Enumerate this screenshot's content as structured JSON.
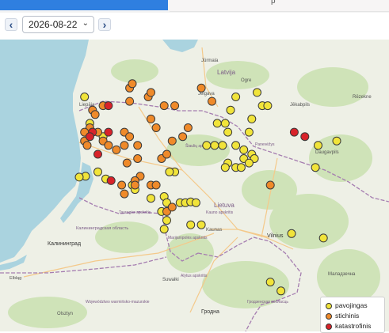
{
  "tabs": {
    "active_label": "",
    "inactive_label": "p"
  },
  "toolbar": {
    "prev_label": "‹",
    "next_label": "›",
    "date_value": "2026-08-22"
  },
  "map_labels": {
    "latvija": "Latvija",
    "lietuva": "Lietuva",
    "jurmala": "Jūrmala",
    "jelgava": "Jelgava",
    "ogre": "Ogre",
    "liepaja": "Liepāja",
    "jekabpils": "Jēkabpils",
    "rezekne": "Rēzekne",
    "daugavpils": "Daugavpils",
    "vilnius": "Vilnius",
    "kaunas": "Kaunas",
    "kaliningrad": "Калининград",
    "kaliningrad_oblast": "Калининградская область",
    "suwalki": "Suwałki",
    "grodno": "Гродна",
    "elblag": "Elbląg",
    "olsztyn": "Olsztyn",
    "warminsko": "Województwo warmińsko-mazurskie",
    "molodechno": "Маладзечна",
    "grodno_obl": "Гродзенская вобласць",
    "alytus": "Alytus apskritis",
    "kauno": "Kauno apskritis",
    "siauliu": "Šiaulių apskritis",
    "panevezys": "Panevėžys",
    "marijampole": "Marijampolės apskritis",
    "taurages": "Tauragės apskritis"
  },
  "legend": {
    "items": [
      {
        "label": "pavojingas",
        "color": "#f1e43a"
      },
      {
        "label": "stichinis",
        "color": "#ef8a2a"
      },
      {
        "label": "katastrofinis",
        "color": "#d8232a"
      }
    ]
  },
  "markers": {
    "pavojingas": [
      [
        21.1,
        56.05
      ],
      [
        21.2,
        55.75
      ],
      [
        21.45,
        55.6
      ],
      [
        21.35,
        55.2
      ],
      [
        21.12,
        55.15
      ],
      [
        21.0,
        55.14
      ],
      [
        21.5,
        55.12
      ],
      [
        22.0,
        55.05
      ],
      [
        22.05,
        55.0
      ],
      [
        22.35,
        54.9
      ],
      [
        22.6,
        54.92
      ],
      [
        22.65,
        54.85
      ],
      [
        22.9,
        54.85
      ],
      [
        23.0,
        54.85
      ],
      [
        23.1,
        54.86
      ],
      [
        23.2,
        54.85
      ],
      [
        22.55,
        54.75
      ],
      [
        22.65,
        54.65
      ],
      [
        22.6,
        54.55
      ],
      [
        23.3,
        54.6
      ],
      [
        23.6,
        55.75
      ],
      [
        23.75,
        55.75
      ],
      [
        23.85,
        55.9
      ],
      [
        23.95,
        56.05
      ],
      [
        24.35,
        56.1
      ],
      [
        24.45,
        55.95
      ],
      [
        24.55,
        55.95
      ],
      [
        24.25,
        55.8
      ],
      [
        24.2,
        55.65
      ],
      [
        23.8,
        55.65
      ],
      [
        23.4,
        55.5
      ],
      [
        23.55,
        55.5
      ],
      [
        23.7,
        55.5
      ],
      [
        23.95,
        55.5
      ],
      [
        24.1,
        55.45
      ],
      [
        24.25,
        55.4
      ],
      [
        24.1,
        55.35
      ],
      [
        24.3,
        55.35
      ],
      [
        24.2,
        55.3
      ],
      [
        23.8,
        55.3
      ],
      [
        23.75,
        55.25
      ],
      [
        23.95,
        55.25
      ],
      [
        24.05,
        55.25
      ],
      [
        22.8,
        55.2
      ],
      [
        22.7,
        55.2
      ],
      [
        23.1,
        54.6
      ],
      [
        25.5,
        55.5
      ],
      [
        25.85,
        55.55
      ],
      [
        25.45,
        55.25
      ],
      [
        25.0,
        54.5
      ],
      [
        25.6,
        54.45
      ],
      [
        24.6,
        53.95
      ],
      [
        24.8,
        53.85
      ]
    ],
    "stichinis": [
      [
        21.45,
        55.95
      ],
      [
        21.25,
        55.9
      ],
      [
        21.3,
        55.85
      ],
      [
        21.2,
        55.7
      ],
      [
        21.25,
        55.65
      ],
      [
        21.35,
        55.65
      ],
      [
        21.1,
        55.65
      ],
      [
        21.1,
        55.55
      ],
      [
        21.15,
        55.5
      ],
      [
        21.45,
        55.55
      ],
      [
        21.55,
        55.5
      ],
      [
        21.7,
        55.45
      ],
      [
        21.85,
        55.65
      ],
      [
        21.95,
        55.6
      ],
      [
        21.85,
        55.5
      ],
      [
        22.1,
        55.5
      ],
      [
        22.1,
        55.35
      ],
      [
        21.9,
        55.3
      ],
      [
        22.55,
        55.35
      ],
      [
        22.65,
        55.4
      ],
      [
        22.15,
        55.15
      ],
      [
        22.05,
        55.1
      ],
      [
        22.05,
        55.05
      ],
      [
        21.8,
        55.05
      ],
      [
        21.85,
        54.95
      ],
      [
        22.35,
        55.05
      ],
      [
        22.45,
        55.05
      ],
      [
        22.75,
        55.55
      ],
      [
        22.95,
        55.6
      ],
      [
        23.05,
        55.7
      ],
      [
        22.45,
        55.7
      ],
      [
        22.35,
        55.8
      ],
      [
        22.6,
        55.95
      ],
      [
        22.8,
        55.95
      ],
      [
        22.3,
        56.05
      ],
      [
        22.35,
        56.1
      ],
      [
        21.95,
        56.0
      ],
      [
        21.95,
        56.15
      ],
      [
        22.0,
        56.2
      ],
      [
        23.3,
        56.15
      ],
      [
        23.5,
        56.0
      ],
      [
        22.65,
        54.75
      ],
      [
        22.75,
        54.8
      ],
      [
        24.6,
        55.05
      ]
    ],
    "katastrofinis": [
      [
        21.55,
        55.95
      ],
      [
        21.25,
        55.65
      ],
      [
        21.55,
        55.65
      ],
      [
        21.2,
        55.6
      ],
      [
        21.35,
        55.4
      ],
      [
        21.6,
        55.1
      ],
      [
        25.05,
        55.65
      ],
      [
        25.25,
        55.6
      ]
    ]
  }
}
